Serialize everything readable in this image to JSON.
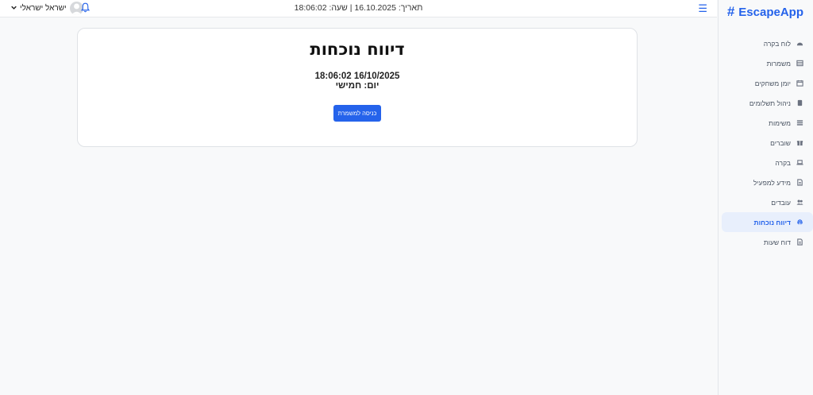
{
  "brand": {
    "name": "EscapeApp",
    "icon": "hash-icon"
  },
  "topbar": {
    "datetime": "תאריך: 16.10.2025 | שעה: 18:06:02",
    "user_name": "ישראל ישראלי",
    "menu_icon": "hamburger-icon"
  },
  "sidebar": {
    "items": [
      {
        "label": "לוח בקרה",
        "icon": "dashboard-icon",
        "active": false
      },
      {
        "label": "משמרות",
        "icon": "table-icon",
        "active": false
      },
      {
        "label": "יומן משחקים",
        "icon": "calendar-icon",
        "active": false
      },
      {
        "label": "ניהול תשלומים",
        "icon": "book-icon",
        "active": false
      },
      {
        "label": "משימות",
        "icon": "list-icon",
        "active": false
      },
      {
        "label": "שוברים",
        "icon": "gift-icon",
        "active": false
      },
      {
        "label": "בקרה",
        "icon": "laptop-icon",
        "active": false
      },
      {
        "label": "מידע למפעיל",
        "icon": "document-icon",
        "active": false
      },
      {
        "label": "עובדים",
        "icon": "users-icon",
        "active": false
      },
      {
        "label": "דיווח נוכחות",
        "icon": "fingerprint-icon",
        "active": true
      },
      {
        "label": "דוח שעות",
        "icon": "report-icon",
        "active": false
      }
    ]
  },
  "main": {
    "title": "דיווח נוכחות",
    "timestamp": "18:06:02 16/10/2025",
    "day": "יום: חמישי",
    "enter_button": "כניסה למשמרת"
  },
  "colors": {
    "accent": "#2563eb",
    "active_bg": "#e8effc"
  }
}
